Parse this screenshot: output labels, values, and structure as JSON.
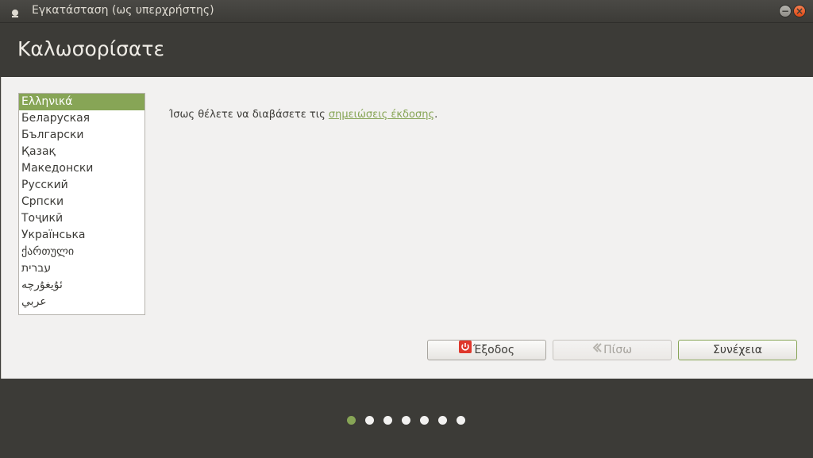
{
  "window": {
    "title": "Εγκατάσταση (ως υπερχρήστης)"
  },
  "header": {
    "title": "Καλωσορίσατε"
  },
  "languages": {
    "selected_index": 0,
    "items": [
      "Ελληνικά",
      "Беларуская",
      "Български",
      "Қазақ",
      "Македонски",
      "Русский",
      "Српски",
      "Тоҷикӣ",
      "Українська",
      "ქართული",
      "עברית",
      "ئۇيغۇرچە",
      "عربي"
    ]
  },
  "release": {
    "text_before": "Ίσως θέλετε να διαβάσετε τις ",
    "link": "σημειώσεις έκδοσης",
    "text_after": "."
  },
  "buttons": {
    "quit": "Έξοδος",
    "back": "Πίσω",
    "continue": "Συνέχεια"
  },
  "progress": {
    "steps": 7,
    "current_step": 1
  },
  "colors": {
    "accent": "#87a556",
    "dark_bg": "#3c3b37",
    "content_bg": "#f2f1f0",
    "quit_icon": "#df382c"
  }
}
